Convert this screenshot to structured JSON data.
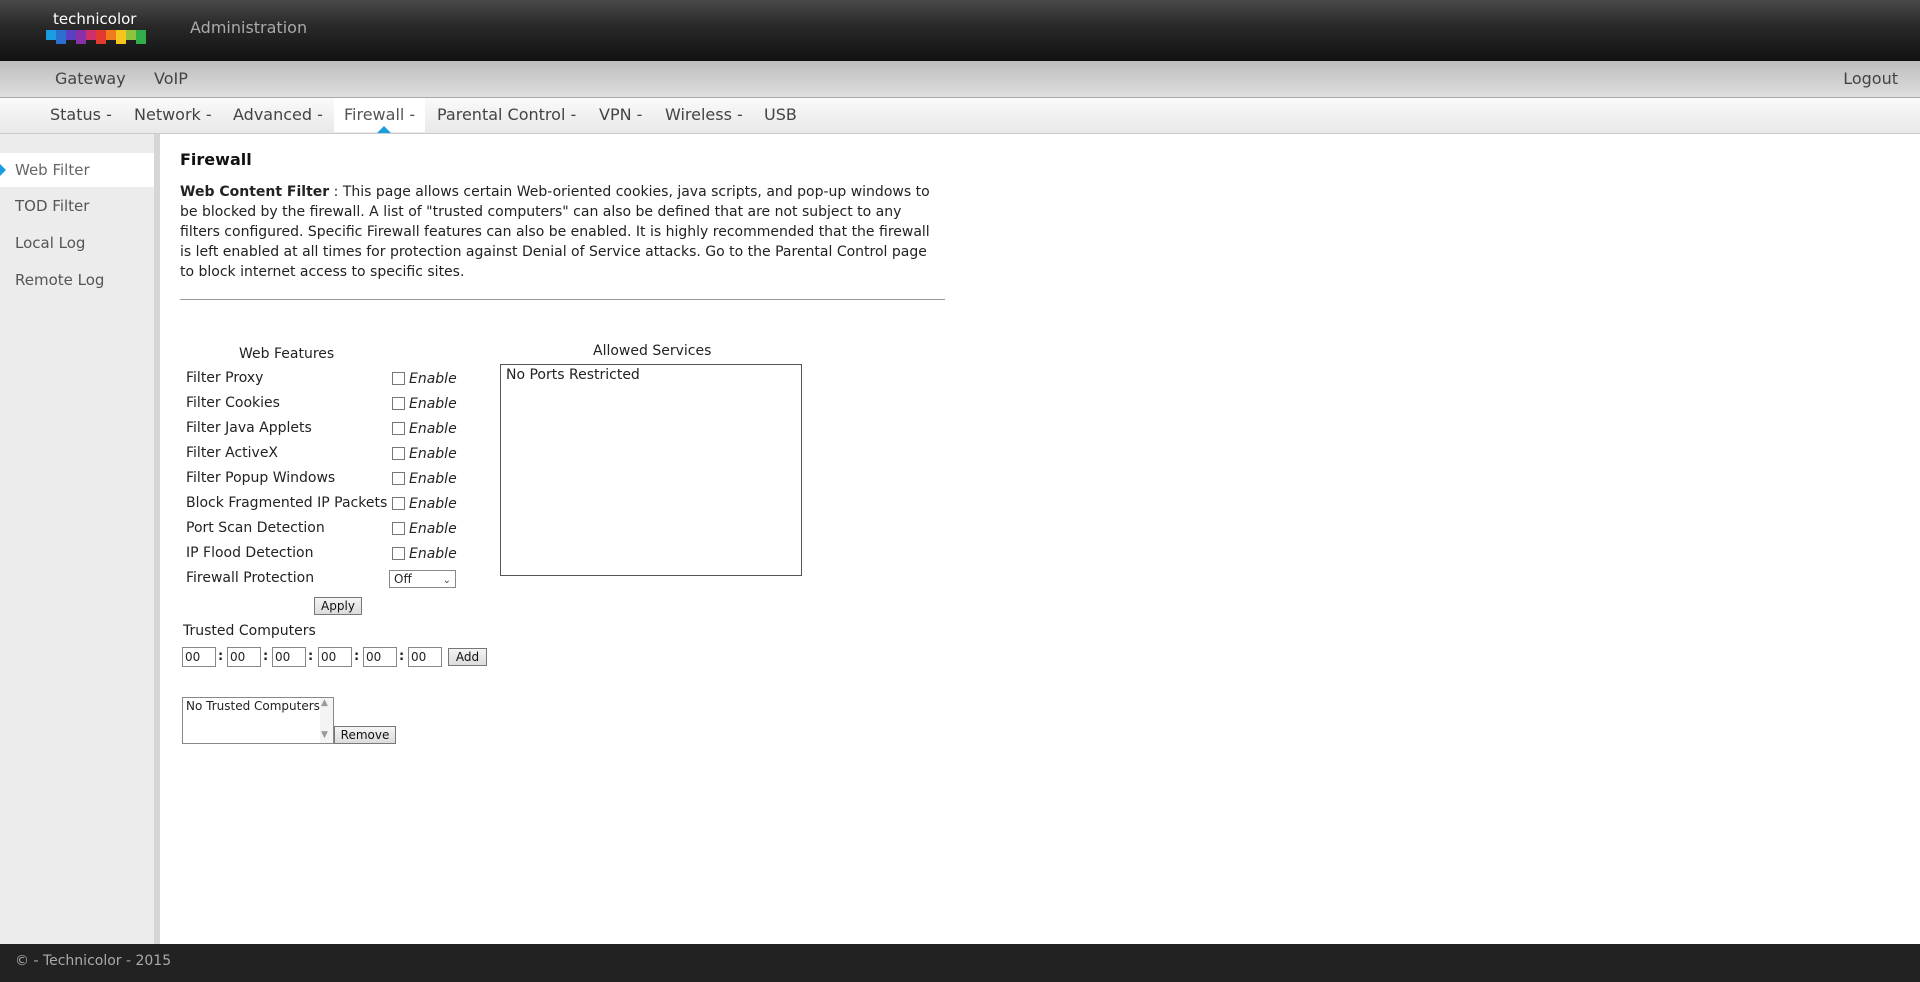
{
  "header": {
    "logo_text": "technicolor",
    "logo_colors": [
      "#1a9de0",
      "#2c6fd1",
      "#5a3fc1",
      "#8a2fa8",
      "#d12f6a",
      "#e23b2e",
      "#f07b1d",
      "#f6c51d",
      "#8fc43a",
      "#2fae4a"
    ],
    "title": "Administration"
  },
  "nav1": {
    "items": [
      "Gateway",
      "VoIP"
    ],
    "logout": "Logout"
  },
  "nav2": {
    "items": [
      "Status -",
      "Network -",
      "Advanced -",
      "Firewall -",
      "Parental Control -",
      "VPN -",
      "Wireless -",
      "USB"
    ],
    "active": "Firewall -",
    "accent_color": "#1a9de0"
  },
  "sidebar": {
    "items": [
      "Web Filter",
      "TOD Filter",
      "Local Log",
      "Remote Log"
    ],
    "active": "Web Filter"
  },
  "main": {
    "title": "Firewall",
    "intro_label": "Web Content Filter",
    "intro_sep": " : ",
    "intro_text": "This page allows certain Web-oriented cookies, java scripts, and pop-up windows to be blocked by the firewall. A list of \"trusted computers\" can also be defined that are not subject to any filters configured. Specific Firewall features can also be enabled. It is highly recommended that the firewall is left enabled at all times for protection against Denial of Service attacks. Go to the Parental Control page to block internet access to specific sites.",
    "web_features_heading": "Web Features",
    "features": [
      {
        "label": "Filter Proxy",
        "enable": "Enable",
        "checked": false
      },
      {
        "label": "Filter Cookies",
        "enable": "Enable",
        "checked": false
      },
      {
        "label": "Filter Java Applets",
        "enable": "Enable",
        "checked": false
      },
      {
        "label": "Filter ActiveX",
        "enable": "Enable",
        "checked": false
      },
      {
        "label": "Filter Popup Windows",
        "enable": "Enable",
        "checked": false
      },
      {
        "label": "Block Fragmented IP Packets",
        "enable": "Enable",
        "checked": false
      },
      {
        "label": "Port Scan Detection",
        "enable": "Enable",
        "checked": false
      },
      {
        "label": "IP Flood Detection",
        "enable": "Enable",
        "checked": false
      }
    ],
    "firewall_protection_label": "Firewall Protection",
    "firewall_protection_value": "Off",
    "apply_label": "Apply",
    "allowed_services_heading": "Allowed Services",
    "allowed_services_text": "No Ports Restricted",
    "trusted_heading": "Trusted Computers",
    "mac_fields": [
      "00",
      "00",
      "00",
      "00",
      "00",
      "00"
    ],
    "mac_separator": ":",
    "add_label": "Add",
    "trusted_list_text": "No Trusted Computers",
    "remove_label": "Remove"
  },
  "footer": {
    "text": "© - Technicolor - 2015"
  }
}
